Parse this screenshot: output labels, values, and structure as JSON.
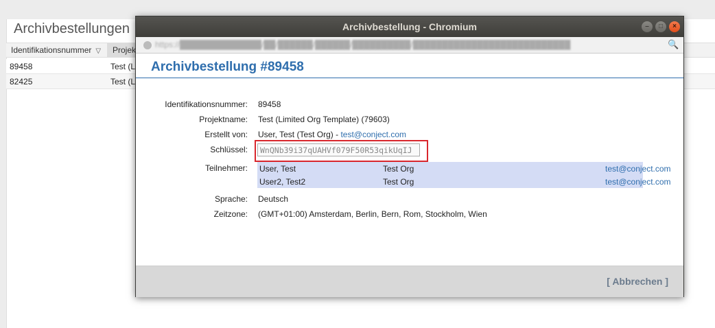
{
  "background": {
    "title": "Archivbestellungen",
    "columns": [
      "Identifikationsnummer",
      "Projek"
    ],
    "sort_icon": "▽",
    "rows": [
      {
        "id": "89458",
        "project": "Test (L"
      },
      {
        "id": "82425",
        "project": "Test (L"
      }
    ]
  },
  "window": {
    "title": "Archivbestellung - Chromium",
    "controls": {
      "minimize": "–",
      "maximize": "□",
      "close": "×"
    },
    "url": "https://██████████████/██/██████/██████/██████████/███████████████████████████",
    "zoom_icon": "🔍"
  },
  "dialog": {
    "title": "Archivbestellung #89458",
    "fields": {
      "id_label": "Identifikationsnummer:",
      "id_value": "89458",
      "project_label": "Projektname:",
      "project_value": "Test (Limited Org Template) (79603)",
      "created_label": "Erstellt von:",
      "created_value": "User, Test (Test Org) - ",
      "created_email": "test@conject.com",
      "key_label": "Schlüssel:",
      "key_value": "WnQNb39i37qUAHVf079F50R53qikUqIJ",
      "participants_label": "Teilnehmer:",
      "language_label": "Sprache:",
      "language_value": "Deutsch",
      "timezone_label": "Zeitzone:",
      "timezone_value": "(GMT+01:00) Amsterdam, Berlin, Bern, Rom, Stockholm, Wien"
    },
    "participants": [
      {
        "name": "User, Test",
        "org": "Test Org",
        "email": "test@conject.com"
      },
      {
        "name": "User2, Test2",
        "org": "Test Org",
        "email": "test@conject.com"
      }
    ],
    "cancel_label": "[ Abbrechen ]"
  },
  "colors": {
    "accent": "#2f6ead",
    "highlight_box": "#d9262c",
    "participants_bg": "#d4dcf5"
  }
}
